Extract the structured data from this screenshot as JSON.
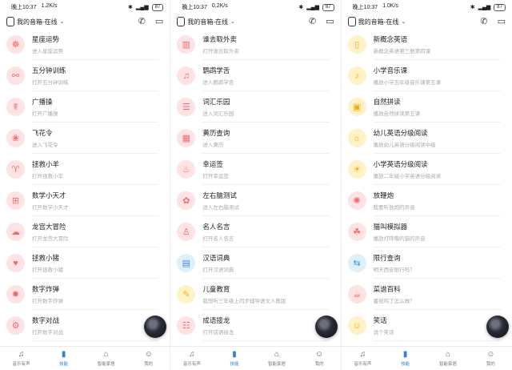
{
  "colors": {
    "accent": "#2d7fe0",
    "pink_bg": "#fde3e4",
    "yellow_bg": "#fff2c6",
    "blue_bg": "#dff0fb"
  },
  "panels": [
    {
      "status": {
        "time": "晚上10:37",
        "speed": "1.2K/s",
        "battery": "87"
      },
      "header": {
        "title": "我的音箱-在线"
      },
      "items": [
        {
          "title": "星座运势",
          "subtitle": "进入星座运势",
          "icon": "☸",
          "color": "pink"
        },
        {
          "title": "五分钟训练",
          "subtitle": "打开五分钟训练",
          "icon": "⚯",
          "color": "pink"
        },
        {
          "title": "广播操",
          "subtitle": "打开广播操",
          "icon": "☤",
          "color": "pink"
        },
        {
          "title": "飞花令",
          "subtitle": "进入飞花令",
          "icon": "❀",
          "color": "pink"
        },
        {
          "title": "拯救小羊",
          "subtitle": "打开拯救小羊",
          "icon": "♈",
          "color": "pink"
        },
        {
          "title": "数学小天才",
          "subtitle": "打开数学小天才",
          "icon": "⊞",
          "color": "pink"
        },
        {
          "title": "龙宫大冒险",
          "subtitle": "打开龙宫大冒险",
          "icon": "☁",
          "color": "pink"
        },
        {
          "title": "拯救小猪",
          "subtitle": "打开拯救小猪",
          "icon": "♥",
          "color": "pink"
        },
        {
          "title": "数字炸弹",
          "subtitle": "打开数字炸弹",
          "icon": "✹",
          "color": "pink"
        },
        {
          "title": "数字对战",
          "subtitle": "打开数字对战",
          "icon": "⚙",
          "color": "pink"
        }
      ]
    },
    {
      "status": {
        "time": "晚上10:37",
        "speed": "0.2K/s",
        "battery": "87"
      },
      "header": {
        "title": "我的音箱-在线"
      },
      "items": [
        {
          "title": "谁去取外卖",
          "subtitle": "打开谁去取外卖",
          "icon": "▥",
          "color": "pink"
        },
        {
          "title": "鹦鹉学舌",
          "subtitle": "进入鹦鹉学舌",
          "icon": "♫",
          "color": "pink"
        },
        {
          "title": "词汇乐园",
          "subtitle": "进入词汇乐园",
          "icon": "☰",
          "color": "pink"
        },
        {
          "title": "黄历查询",
          "subtitle": "进入黄历",
          "icon": "▦",
          "color": "pink"
        },
        {
          "title": "幸运签",
          "subtitle": "打开幸运签",
          "icon": "♨",
          "color": "pink"
        },
        {
          "title": "左右脑测试",
          "subtitle": "进入左右脑测试",
          "icon": "✿",
          "color": "pink"
        },
        {
          "title": "名人名言",
          "subtitle": "打开名人名言",
          "icon": "♙",
          "color": "pink"
        },
        {
          "title": "汉语词典",
          "subtitle": "打开汉语词典",
          "icon": "▤",
          "color": "blu"
        },
        {
          "title": "儿童教育",
          "subtitle": "我想听三年级上同步辅导语文人教版",
          "icon": "✎",
          "color": "yel"
        },
        {
          "title": "成语接龙",
          "subtitle": "打开成语接龙",
          "icon": "☷",
          "color": "pink"
        }
      ]
    },
    {
      "status": {
        "time": "晚上10:37",
        "speed": "1.0K/s",
        "battery": "87"
      },
      "header": {
        "title": "我的音箱-在线"
      },
      "items": [
        {
          "title": "新概念英语",
          "subtitle": "新概念英语第三册第四课",
          "icon": "▯",
          "color": "yel"
        },
        {
          "title": "小学音乐课",
          "subtitle": "播放小学五年级音乐课第五课",
          "icon": "♪",
          "color": "yel"
        },
        {
          "title": "自然拼读",
          "subtitle": "播放自然拼读第五课",
          "icon": "▣",
          "color": "yel"
        },
        {
          "title": "幼儿英语分级阅读",
          "subtitle": "播放幼儿英语分级阅读中级",
          "icon": "☼",
          "color": "yel"
        },
        {
          "title": "小学英语分级阅读",
          "subtitle": "播放二年级小学英语分级阅读",
          "icon": "☀",
          "color": "yel"
        },
        {
          "title": "放鞭炮",
          "subtitle": "我要听放炮的声音",
          "icon": "✺",
          "color": "pink"
        },
        {
          "title": "猫叫模拟器",
          "subtitle": "播放打呼噜的猫的声音",
          "icon": "☘",
          "color": "pink"
        },
        {
          "title": "限行查询",
          "subtitle": "明天西安限行吗？",
          "icon": "⇆",
          "color": "blu"
        },
        {
          "title": "菜谱百科",
          "subtitle": "番茄鸡丁怎么做？",
          "icon": "☕",
          "color": "pink"
        },
        {
          "title": "笑话",
          "subtitle": "说个笑话",
          "icon": "☺",
          "color": "yel"
        }
      ]
    }
  ],
  "tabbar": [
    {
      "label": "音乐有声",
      "icon": "♫"
    },
    {
      "label": "技能",
      "icon": "▮",
      "active": true
    },
    {
      "label": "智能家居",
      "icon": "⌂"
    },
    {
      "label": "我的",
      "icon": "☺"
    }
  ]
}
